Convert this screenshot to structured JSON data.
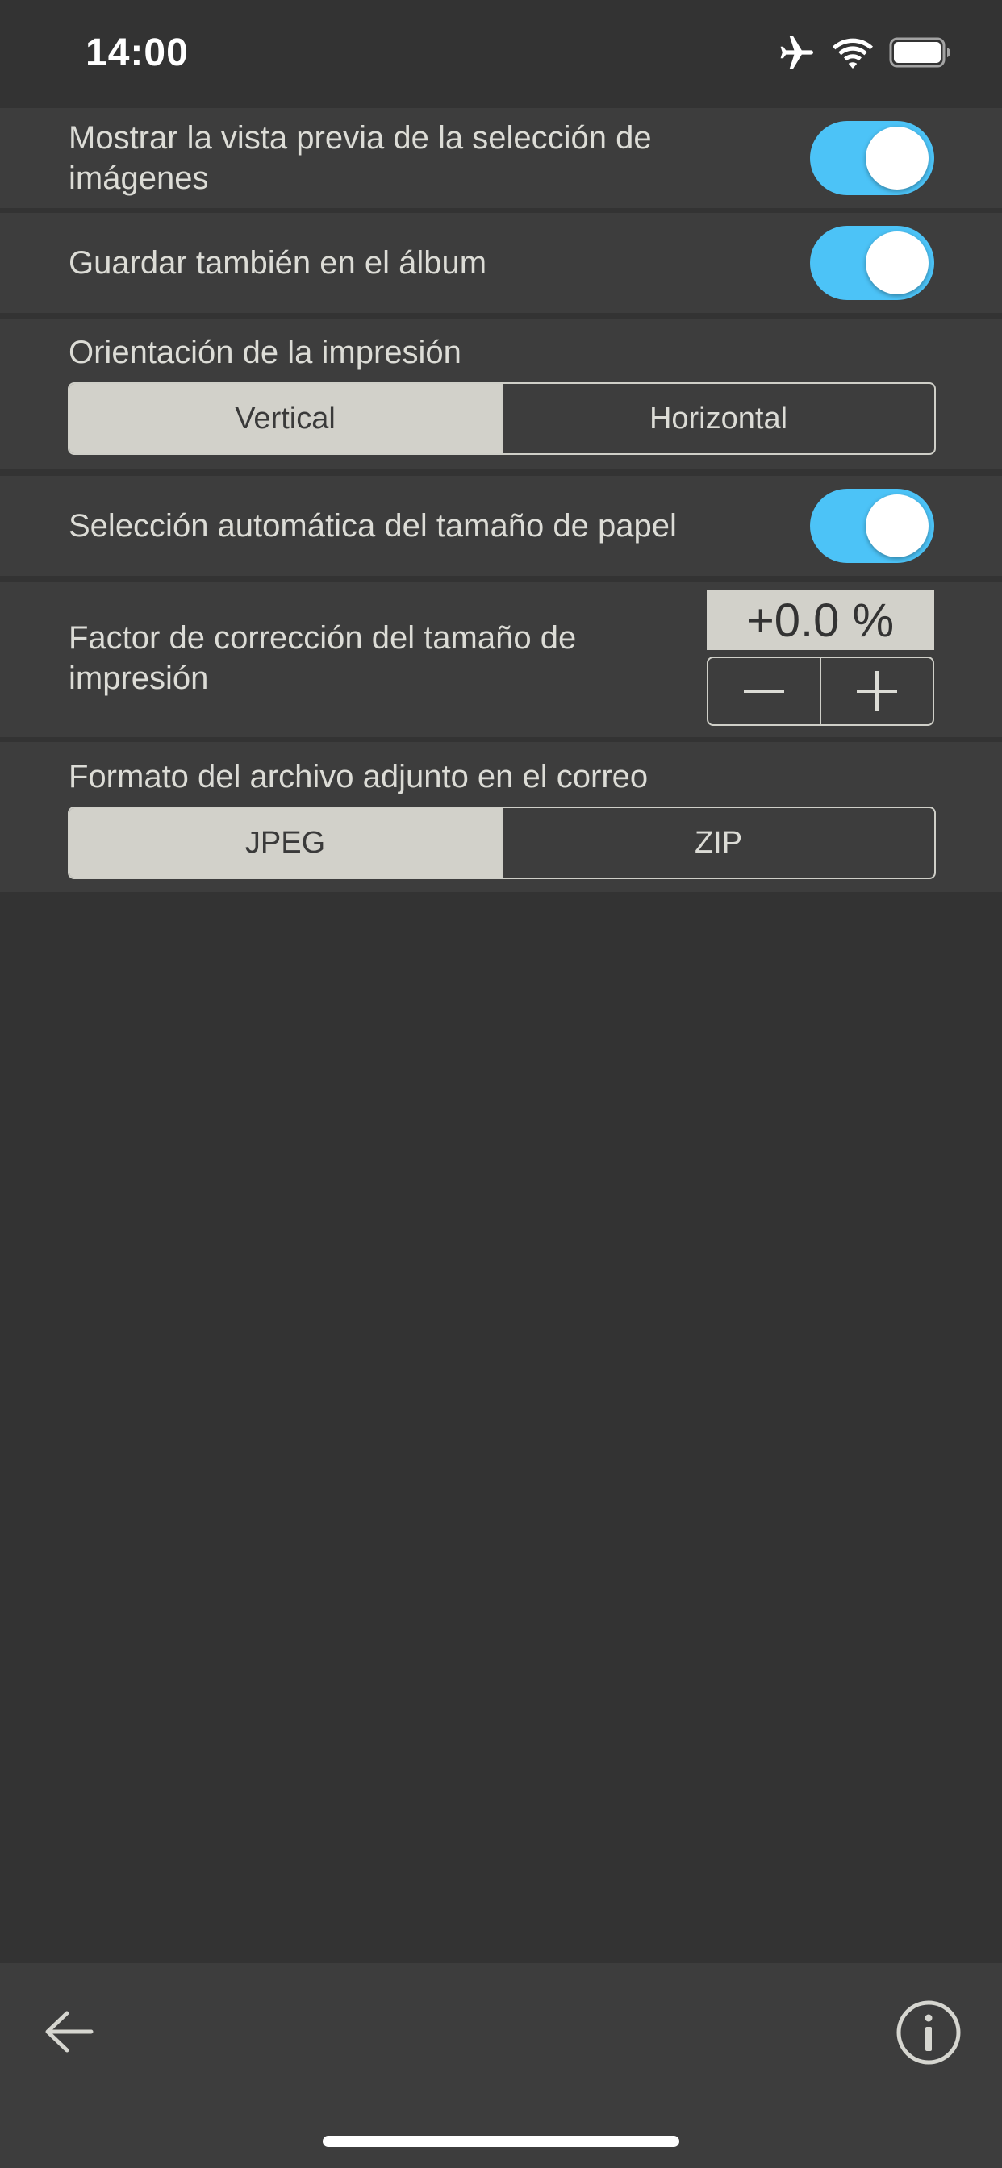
{
  "status_bar": {
    "time": "14:00",
    "icons": [
      "airplane-icon",
      "wifi-icon",
      "battery-icon"
    ]
  },
  "settings": {
    "preview": {
      "label": "Mostrar la vista previa de la selección de imágenes",
      "enabled": true
    },
    "save_album": {
      "label": "Guardar también en el álbum",
      "enabled": true
    },
    "orientation": {
      "label": "Orientación de la impresión",
      "options": [
        "Vertical",
        "Horizontal"
      ],
      "selected": "Vertical"
    },
    "auto_paper": {
      "label": "Selección automática del tamaño de papel",
      "enabled": true
    },
    "size_correction": {
      "label": "Factor de corrección del tamaño de impresión",
      "value": "+0.0 %"
    },
    "attachment_format": {
      "label": "Formato del archivo adjunto en el correo",
      "options": [
        "JPEG",
        "ZIP"
      ],
      "selected": "JPEG"
    }
  },
  "toolbar": {
    "back_icon": "arrow-left-icon",
    "info_icon": "info-icon"
  },
  "colors": {
    "background": "#333333",
    "row": "#3d3d3d",
    "toggle_on": "#4cc3f7",
    "segment_selected": "#d2d1ca"
  }
}
